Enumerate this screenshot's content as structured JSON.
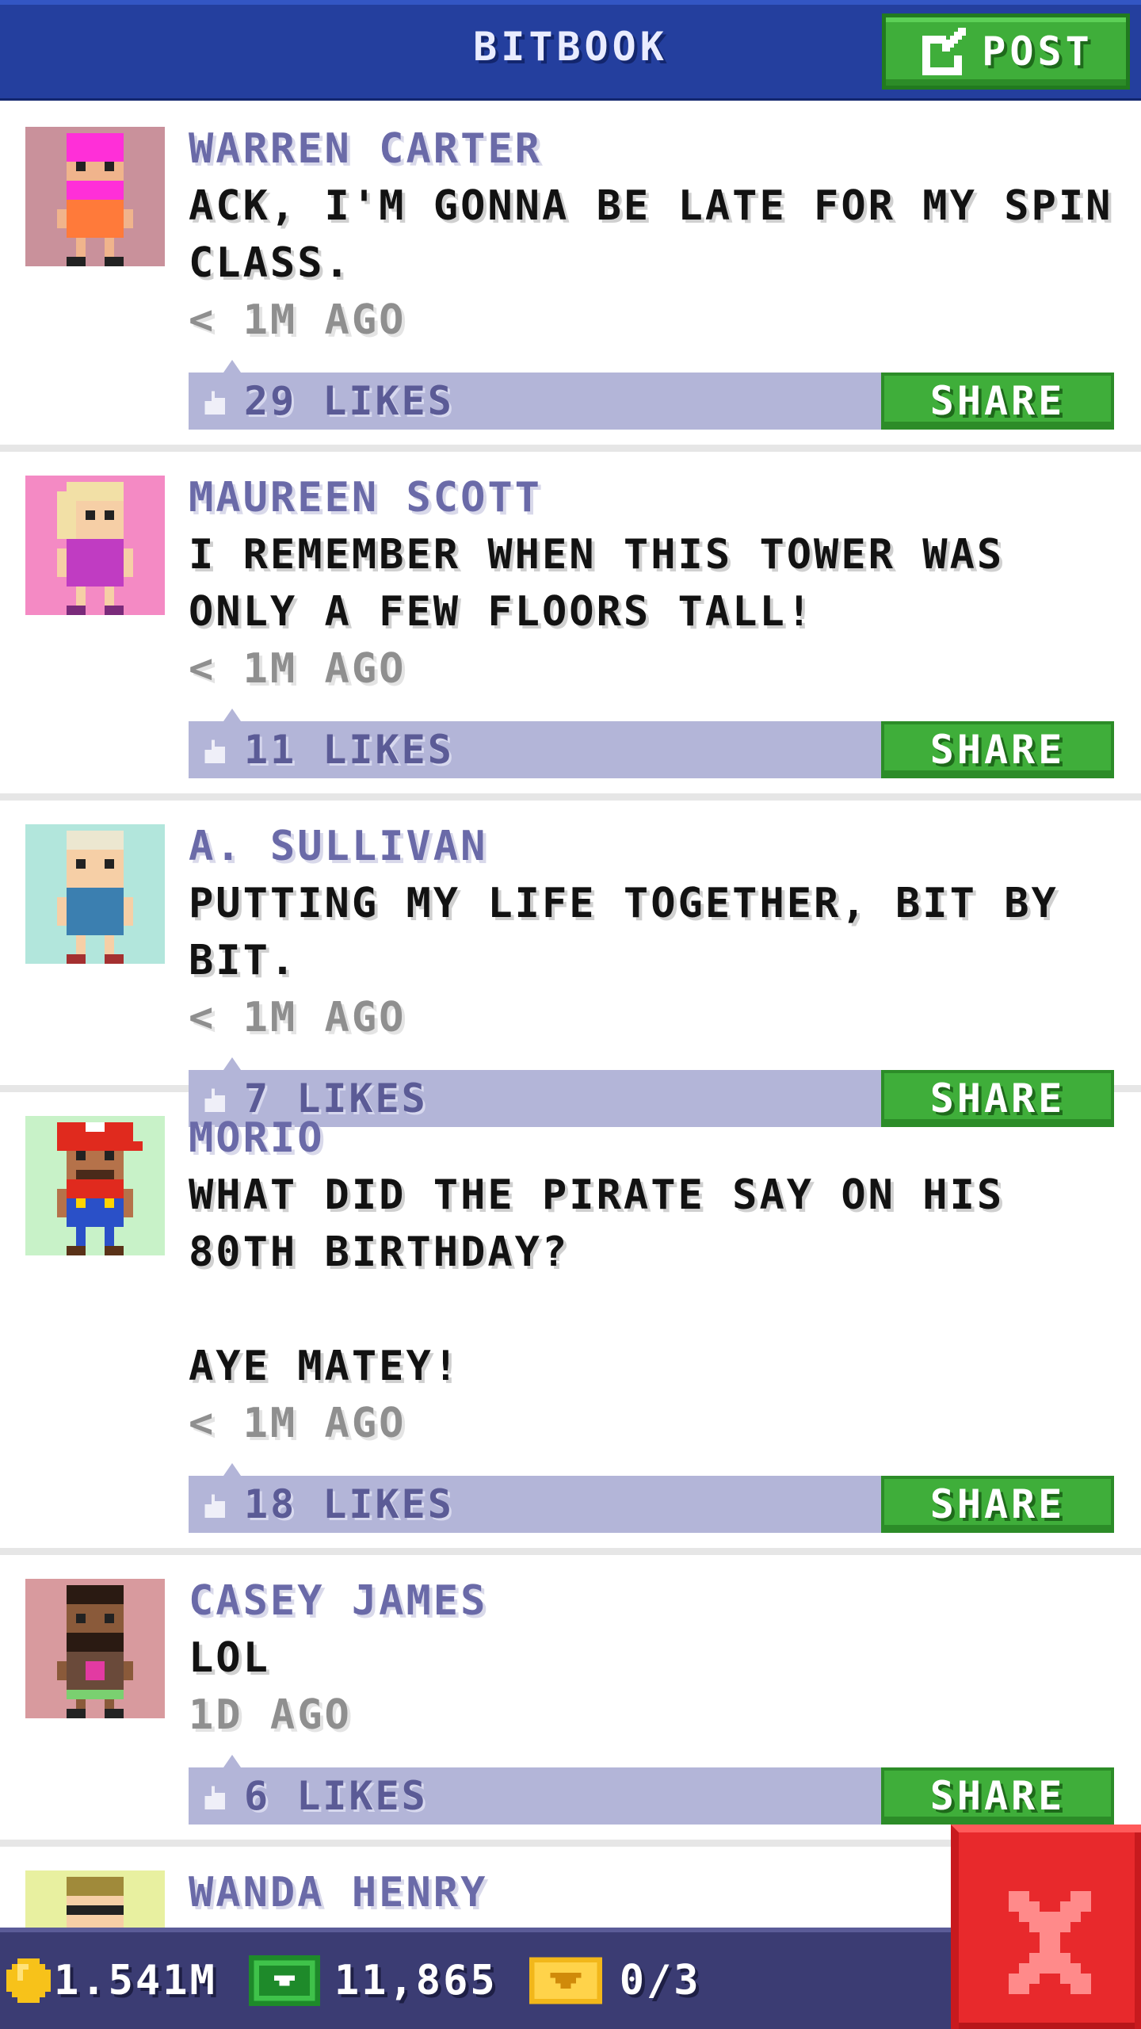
{
  "header": {
    "title": "BITBOOK",
    "post_label": "POST",
    "post_icon": "edit-icon"
  },
  "colors": {
    "header_blue": "#243f9e",
    "button_green": "#3fae3a",
    "likes_bar": "#b3b5d8",
    "author_text": "#6a6aa8",
    "close_red": "#e8292c"
  },
  "posts": [
    {
      "author": "WARREN CARTER",
      "message": "ACK, I'M GONNA BE LATE FOR MY SPIN CLASS.",
      "time": "< 1M AGO",
      "likes": "29 LIKES",
      "share_label": "SHARE",
      "avatar_bg": "#c9919b"
    },
    {
      "author": "MAUREEN SCOTT",
      "message": "I REMEMBER WHEN THIS TOWER WAS ONLY A FEW FLOORS TALL!",
      "time": "< 1M AGO",
      "likes": "11 LIKES",
      "share_label": "SHARE",
      "avatar_bg": "#f48ac4"
    },
    {
      "author": "A. SULLIVAN",
      "message": "PUTTING MY LIFE TOGETHER, BIT BY BIT.",
      "time": "< 1M AGO",
      "likes": "7 LIKES",
      "share_label": "SHARE",
      "avatar_bg": "#b2e6dc"
    },
    {
      "author": "MORIO",
      "message": "WHAT DID THE PIRATE SAY ON HIS 80TH BIRTHDAY?\n\nAYE MATEY!",
      "time": "< 1M AGO",
      "likes": "18 LIKES",
      "share_label": "SHARE",
      "avatar_bg": "#c8f2c8"
    },
    {
      "author": "CASEY JAMES",
      "message": "LOL",
      "time": "1D AGO",
      "likes": "6 LIKES",
      "share_label": "SHARE",
      "avatar_bg": "#d89a9e"
    },
    {
      "author": "WANDA HENRY",
      "avatar_bg": "#e8f0a0"
    }
  ],
  "bottom_bar": {
    "coins": "1.541M",
    "coin_icon": "coin-icon",
    "bux": "11,865",
    "bux_icon": "cash-icon",
    "tickets": "0/3",
    "ticket_icon": "ticket-icon"
  },
  "close_icon": "close-icon"
}
